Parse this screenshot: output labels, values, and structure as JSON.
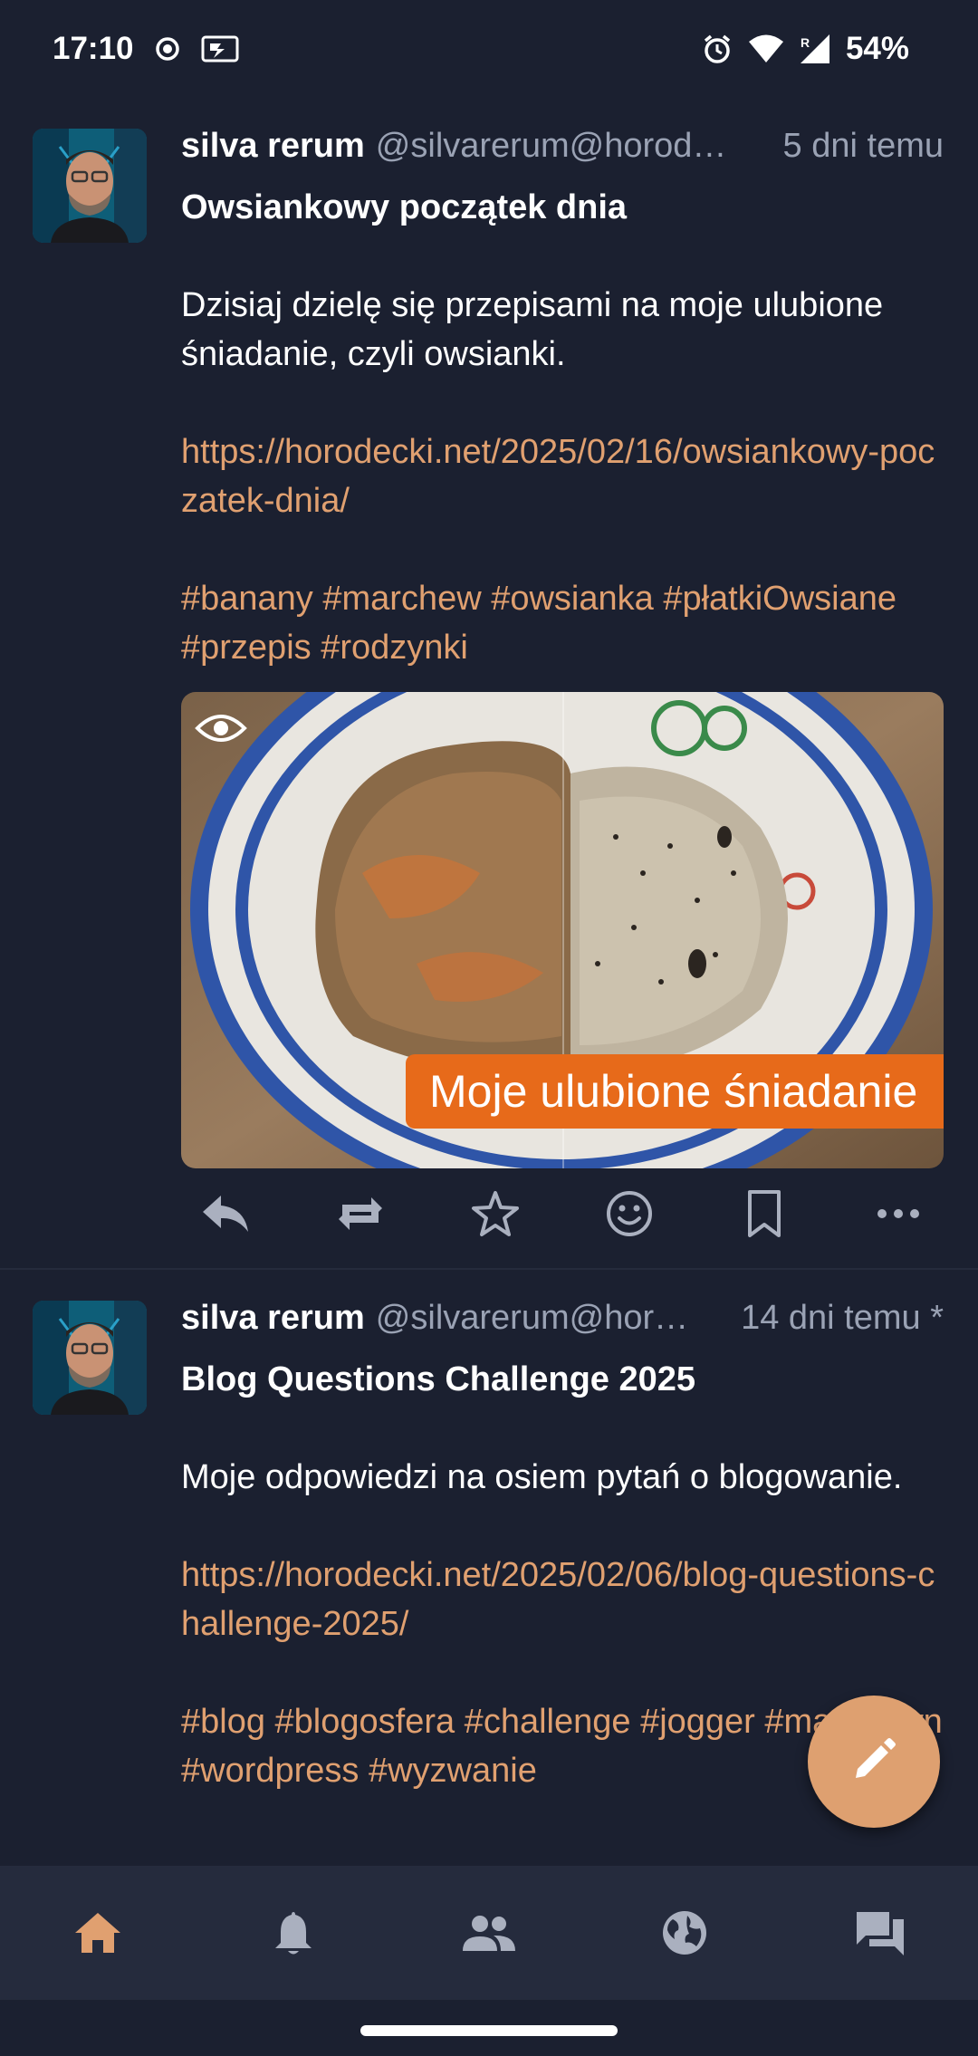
{
  "status_bar": {
    "time": "17:10",
    "battery": "54%",
    "icons": [
      "record-icon",
      "cast-icon",
      "alarm-icon",
      "wifi-icon",
      "signal-icon"
    ]
  },
  "posts": [
    {
      "display_name": "silva rerum",
      "handle": "@silvarerum@horod…",
      "time": "5 dni temu",
      "title": "Owsiankowy początek dnia",
      "text": "Dzisiaj dzielę się przepisami na moje ulubione śniadanie, czyli owsianki.",
      "link": "https://horodecki.net/2025/02/16/owsiankowy-poczatek-dnia/",
      "tags": "#banany #marchew #owsianka #płatkiOwsiane #przepis #rodzynki",
      "media_caption": "Moje ulubione śniadanie"
    },
    {
      "display_name": "silva rerum",
      "handle": "@silvarerum@hor…",
      "time": "14 dni temu *",
      "title": "Blog Questions Challenge 2025",
      "text": "Moje odpowiedzi na osiem pytań o blogowanie.",
      "link": "https://horodecki.net/2025/02/06/blog-questions-challenge-2025/",
      "tags": "#blog #blogosfera #challenge #jogger #markdown #wordpress #wyzwanie"
    }
  ],
  "actions": [
    "reply-icon",
    "boost-icon",
    "favourite-icon",
    "emoji-reaction-icon",
    "bookmark-icon",
    "more-icon"
  ],
  "bottom_nav": [
    "home-icon",
    "notifications-icon",
    "people-icon",
    "globe-icon",
    "conversations-icon"
  ],
  "colors": {
    "background": "#1b2030",
    "accent": "#e0a070",
    "nav_background": "#252b3d",
    "fab": "#dea070",
    "muted_text": "#9aa2b4"
  }
}
